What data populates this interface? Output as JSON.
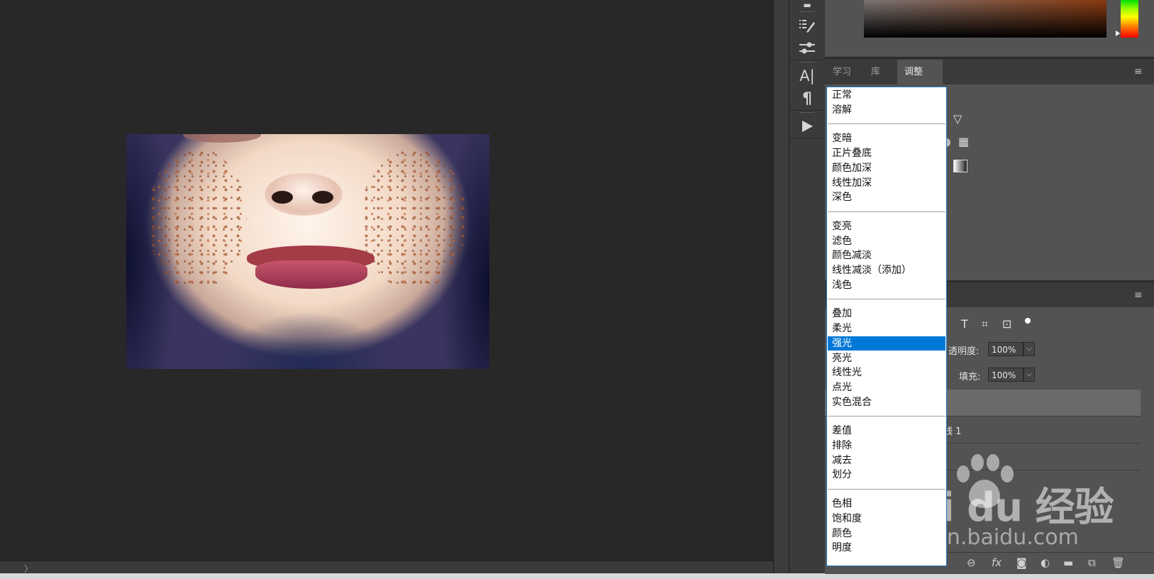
{
  "panels": {
    "tabs": [
      {
        "label": "学习",
        "active": false
      },
      {
        "label": "库",
        "active": false
      },
      {
        "label": "调整",
        "active": true
      }
    ],
    "menu_icon": "hamburger-menu-icon"
  },
  "toolbar_icons": [
    "brush-presets-icon",
    "adjust-sliders-icon",
    "character-icon",
    "paragraph-icon",
    "play-actions-icon"
  ],
  "blend_modes": {
    "selected": "强光",
    "groups": [
      [
        "正常",
        "溶解"
      ],
      [
        "变暗",
        "正片叠底",
        "颜色加深",
        "线性加深",
        "深色"
      ],
      [
        "变亮",
        "滤色",
        "颜色减淡",
        "线性减淡（添加）",
        "浅色"
      ],
      [
        "叠加",
        "柔光",
        "强光",
        "亮光",
        "线性光",
        "点光",
        "实色混合"
      ],
      [
        "差值",
        "排除",
        "减去",
        "划分"
      ],
      [
        "色相",
        "饱和度",
        "颜色",
        "明度"
      ]
    ]
  },
  "layers": {
    "opacity_label": "透明度:",
    "opacity_value": "100%",
    "fill_label": "填充:",
    "fill_value": "100%",
    "layer_name_partial": "线 1"
  },
  "colors": {
    "selected_highlight": "#0078d7",
    "dropdown_border": "#1978c8"
  },
  "watermark": {
    "logo": "Bai du 经验",
    "url": "jingyan.baidu.com"
  }
}
